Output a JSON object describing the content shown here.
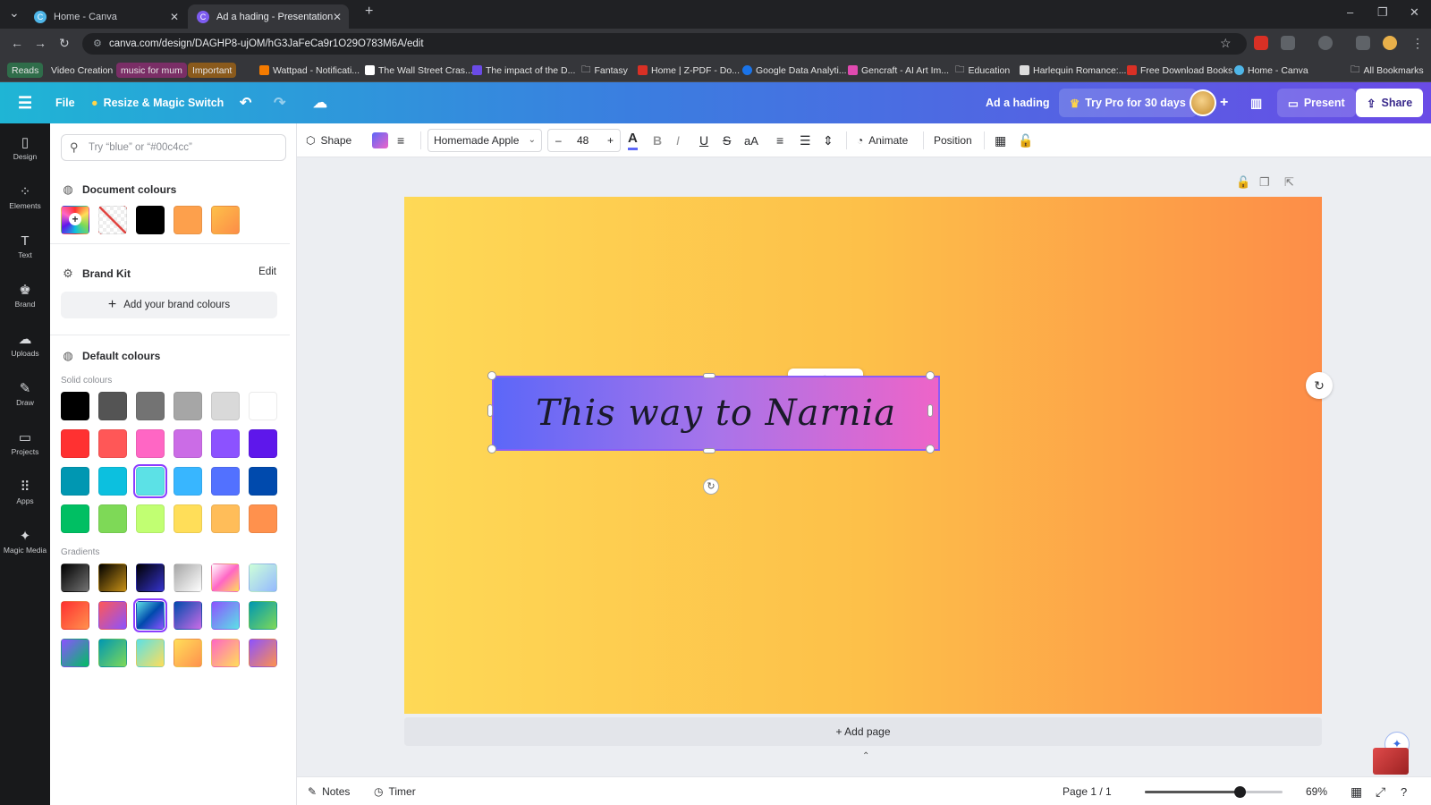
{
  "browser": {
    "tabs": [
      {
        "title": "Home - Canva",
        "active": false
      },
      {
        "title": "Ad a hading - Presentation",
        "active": true
      }
    ],
    "url": "canva.com/design/DAGHP8-ujOM/hG3JaFeCa9r1O29O783M6A/edit",
    "bookmarks": [
      {
        "label": "Reads",
        "chip_color": "#2f6d4a"
      },
      {
        "label": "Video Creation",
        "chip_color": ""
      },
      {
        "label": "music for mum",
        "chip_color": "#7a2e66"
      },
      {
        "label": "Important",
        "chip_color": "#8a5a1c"
      },
      {
        "label": "Wattpad - Notificati..."
      },
      {
        "label": "The Wall Street Cras..."
      },
      {
        "label": "The impact of the D..."
      },
      {
        "label": "Fantasy"
      },
      {
        "label": "Home | Z-PDF - Do..."
      },
      {
        "label": "Google Data Analyti..."
      },
      {
        "label": "Gencraft - AI Art Im..."
      },
      {
        "label": "Education"
      },
      {
        "label": "Harlequin Romance:..."
      },
      {
        "label": "Free Download Books"
      },
      {
        "label": "Home - Canva"
      },
      {
        "label": "All Bookmarks"
      }
    ]
  },
  "topbar": {
    "file": "File",
    "resize": "Resize & Magic Switch",
    "design_title": "Ad a hading",
    "try_pro": "Try Pro for 30 days",
    "present": "Present",
    "share": "Share"
  },
  "rail": [
    {
      "label": "Design",
      "icon": "design-icon",
      "glyph": "▯"
    },
    {
      "label": "Elements",
      "icon": "elements-icon",
      "glyph": "⁘"
    },
    {
      "label": "Text",
      "icon": "text-icon",
      "glyph": "T"
    },
    {
      "label": "Brand",
      "icon": "brand-icon",
      "glyph": "♚"
    },
    {
      "label": "Uploads",
      "icon": "uploads-icon",
      "glyph": "☁"
    },
    {
      "label": "Draw",
      "icon": "draw-icon",
      "glyph": "✎"
    },
    {
      "label": "Projects",
      "icon": "projects-icon",
      "glyph": "▭"
    },
    {
      "label": "Apps",
      "icon": "apps-icon",
      "glyph": "⠿"
    },
    {
      "label": "Magic Media",
      "icon": "magic-media-icon",
      "glyph": "✦"
    }
  ],
  "panel": {
    "search_placeholder": "Try “blue” or “#00c4cc”",
    "document_colours_title": "Document colours",
    "document_colours": [
      "add",
      "transparent",
      "#000000",
      "#fda04c",
      "gradient:#fdc049,#fd8d48"
    ],
    "brand_kit_title": "Brand Kit",
    "brand_kit_edit": "Edit",
    "add_brand_colours": "Add your brand colours",
    "default_colours_title": "Default colours",
    "solid_label": "Solid colours",
    "solid_colours": [
      [
        "#000000",
        "#545454",
        "#737373",
        "#a6a6a6",
        "#d9d9d9",
        "#ffffff"
      ],
      [
        "#ff3131",
        "#ff5757",
        "#ff66c4",
        "#cb6ce6",
        "#8c52ff",
        "#5e17eb"
      ],
      [
        "#0097b2",
        "#0cc0df",
        "#5ce1e6",
        "#38b6ff",
        "#5271ff",
        "#004aad"
      ],
      [
        "#00bf63",
        "#7ed957",
        "#c1ff72",
        "#ffde59",
        "#ffbd59",
        "#ff914d"
      ]
    ],
    "selected_solid": [
      2,
      2
    ],
    "gradients_label": "Gradients",
    "gradients": [
      [
        "#000000,#737373",
        "#000000,#c89116",
        "#000000,#3533cd",
        "#a6a6a6,#ffffff",
        "#ffffff,#ff66c4,#ffde59",
        "#cdffd8,#94b9ff"
      ],
      [
        "#ff3131,#ff914d",
        "#ff5757,#8c52ff",
        "#5de0e6,#004aad,#8c52ff",
        "#004aad,#cb6ce6",
        "#8c52ff,#5ce1e6",
        "#0097b2,#7ed957"
      ],
      [
        "#8c52ff,#00bf63",
        "#0097b2,#7ed957",
        "#5ce1e6,#ffde59",
        "#ffde59,#ff914d",
        "#ff66c4,#ffde59",
        "#8c52ff,#ff914d"
      ]
    ],
    "selected_gradient": [
      1,
      2
    ]
  },
  "toolbar": {
    "shape": "Shape",
    "font": "Homemade Apple",
    "font_size": "48",
    "animate": "Animate",
    "position": "Position"
  },
  "canvas": {
    "text": "This way to Narnia",
    "page_bg": "#fed956,#fd8d48",
    "text_bg": "#5c67f8,#ee64c8",
    "add_page": "+ Add page"
  },
  "bottombar": {
    "notes": "Notes",
    "timer": "Timer",
    "page_indicator": "Page 1 / 1",
    "zoom": "69%",
    "zoom_fraction": 0.69
  }
}
